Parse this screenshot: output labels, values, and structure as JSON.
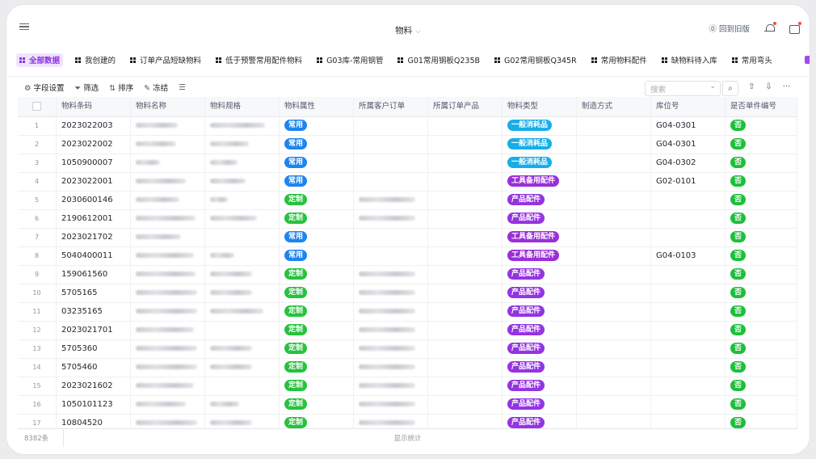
{
  "header": {
    "title": "物料",
    "back_to_old": "回到旧版"
  },
  "views": [
    {
      "label": "全部数据",
      "active": true
    },
    {
      "label": "我创建的"
    },
    {
      "label": "订单产品短缺物料"
    },
    {
      "label": "低于预警常用配件物料"
    },
    {
      "label": "G03库-常用钢管"
    },
    {
      "label": "G01常用钢板Q235B"
    },
    {
      "label": "G02常用钢板Q345R"
    },
    {
      "label": "常用物料配件"
    },
    {
      "label": "缺物料待入库"
    },
    {
      "label": "常用弯头"
    }
  ],
  "toolbar": {
    "fields": "字段设置",
    "filter": "筛选",
    "sort": "排序",
    "freeze": "冻结",
    "search_placeholder": "搜索"
  },
  "columns": [
    "物料条码",
    "物料名称",
    "物料规格",
    "物料属性",
    "所属客户订单",
    "所属订单产品",
    "物料类型",
    "制造方式",
    "库位号",
    "是否单件编号"
  ],
  "colors": {
    "attr_common": "#1e84ef",
    "attr_custom": "#26c33d",
    "type_consumable": "#17aee8",
    "type_tool": "#9a2fd8",
    "type_product": "#9434e2",
    "no_tag": "#1fbf3b",
    "accent": "#8c36e0"
  },
  "rows": [
    {
      "idx": "1",
      "code": "2023022003",
      "attr": "常用",
      "attr_kind": "common",
      "type": "一般消耗品",
      "type_kind": "consumable",
      "loc": "G04-0301",
      "single": "否",
      "has_order": false,
      "n1": 52,
      "n2": 68,
      "n3": 0
    },
    {
      "idx": "2",
      "code": "2023022002",
      "attr": "常用",
      "attr_kind": "common",
      "type": "一般消耗品",
      "type_kind": "consumable",
      "loc": "G04-0301",
      "single": "否",
      "has_order": false,
      "n1": 50,
      "n2": 48,
      "n3": 0
    },
    {
      "idx": "3",
      "code": "1050900007",
      "attr": "常用",
      "attr_kind": "common",
      "type": "一般消耗品",
      "type_kind": "consumable",
      "loc": "G04-0302",
      "single": "否",
      "has_order": false,
      "n1": 30,
      "n2": 34,
      "n3": 0
    },
    {
      "idx": "4",
      "code": "2023022001",
      "attr": "常用",
      "attr_kind": "common",
      "type": "工具备用配件",
      "type_kind": "tool",
      "loc": "G02-0101",
      "single": "否",
      "has_order": false,
      "n1": 62,
      "n2": 44,
      "n3": 0
    },
    {
      "idx": "5",
      "code": "2030600146",
      "attr": "定制",
      "attr_kind": "custom",
      "type": "产品配件",
      "type_kind": "product",
      "loc": "",
      "single": "否",
      "has_order": true,
      "n1": 54,
      "n2": 22,
      "n3": 70
    },
    {
      "idx": "6",
      "code": "2190612001",
      "attr": "定制",
      "attr_kind": "custom",
      "type": "产品配件",
      "type_kind": "product",
      "loc": "",
      "single": "否",
      "has_order": true,
      "n1": 74,
      "n2": 58,
      "n3": 70
    },
    {
      "idx": "7",
      "code": "2023021702",
      "attr": "常用",
      "attr_kind": "common",
      "type": "工具备用配件",
      "type_kind": "tool",
      "loc": "",
      "single": "否",
      "has_order": false,
      "n1": 56,
      "n2": 0,
      "n3": 0
    },
    {
      "idx": "8",
      "code": "5040400011",
      "attr": "常用",
      "attr_kind": "common",
      "type": "工具备用配件",
      "type_kind": "tool",
      "loc": "G04-0103",
      "single": "否",
      "has_order": false,
      "n1": 72,
      "n2": 30,
      "n3": 0
    },
    {
      "idx": "9",
      "code": "159061560",
      "attr": "定制",
      "attr_kind": "custom",
      "type": "产品配件",
      "type_kind": "product",
      "loc": "",
      "single": "否",
      "has_order": true,
      "n1": 74,
      "n2": 52,
      "n3": 70
    },
    {
      "idx": "10",
      "code": "5705165",
      "attr": "定制",
      "attr_kind": "custom",
      "type": "产品配件",
      "type_kind": "product",
      "loc": "",
      "single": "否",
      "has_order": true,
      "n1": 76,
      "n2": 52,
      "n3": 70
    },
    {
      "idx": "11",
      "code": "03235165",
      "attr": "定制",
      "attr_kind": "custom",
      "type": "产品配件",
      "type_kind": "product",
      "loc": "",
      "single": "否",
      "has_order": true,
      "n1": 76,
      "n2": 66,
      "n3": 70
    },
    {
      "idx": "12",
      "code": "2023021701",
      "attr": "定制",
      "attr_kind": "custom",
      "type": "产品配件",
      "type_kind": "product",
      "loc": "",
      "single": "否",
      "has_order": true,
      "n1": 72,
      "n2": 0,
      "n3": 70
    },
    {
      "idx": "13",
      "code": "5705360",
      "attr": "定制",
      "attr_kind": "custom",
      "type": "产品配件",
      "type_kind": "product",
      "loc": "",
      "single": "否",
      "has_order": true,
      "n1": 76,
      "n2": 52,
      "n3": 70
    },
    {
      "idx": "14",
      "code": "5705460",
      "attr": "定制",
      "attr_kind": "custom",
      "type": "产品配件",
      "type_kind": "product",
      "loc": "",
      "single": "否",
      "has_order": true,
      "n1": 76,
      "n2": 52,
      "n3": 70
    },
    {
      "idx": "15",
      "code": "2023021602",
      "attr": "定制",
      "attr_kind": "custom",
      "type": "产品配件",
      "type_kind": "product",
      "loc": "",
      "single": "否",
      "has_order": true,
      "n1": 72,
      "n2": 0,
      "n3": 70
    },
    {
      "idx": "16",
      "code": "1050101123",
      "attr": "定制",
      "attr_kind": "custom",
      "type": "产品配件",
      "type_kind": "product",
      "loc": "",
      "single": "否",
      "has_order": true,
      "n1": 62,
      "n2": 36,
      "n3": 70
    },
    {
      "idx": "17",
      "code": "10804520",
      "attr": "定制",
      "attr_kind": "custom",
      "type": "产品配件",
      "type_kind": "product",
      "loc": "",
      "single": "否",
      "has_order": true,
      "n1": 76,
      "n2": 52,
      "n3": 70
    }
  ],
  "footer": {
    "count": "8382条",
    "stats": "显示统计"
  }
}
